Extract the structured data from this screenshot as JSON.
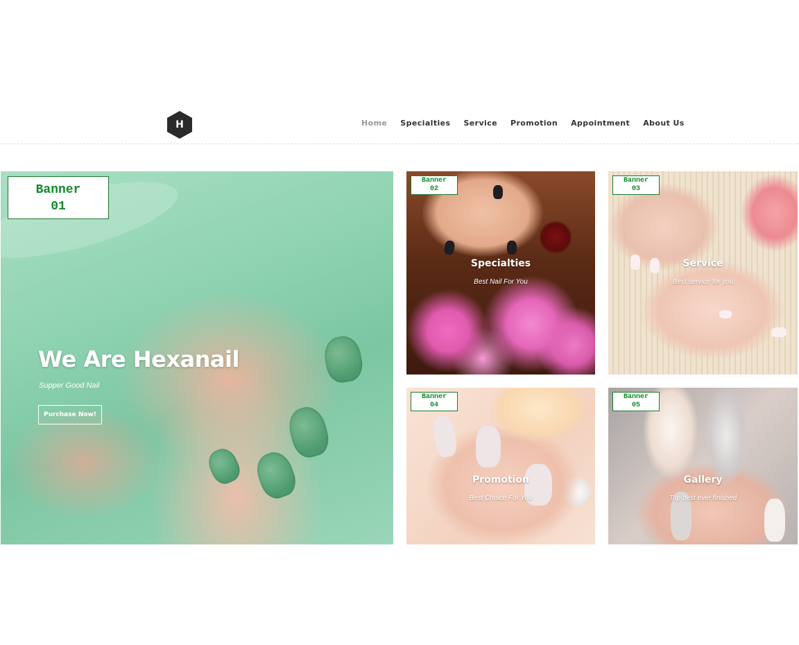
{
  "header": {
    "logo_letter": "H",
    "nav": [
      {
        "label": "Home",
        "active": true
      },
      {
        "label": "Specialties",
        "active": false
      },
      {
        "label": "Service",
        "active": false
      },
      {
        "label": "Promotion",
        "active": false
      },
      {
        "label": "Appointment",
        "active": false
      },
      {
        "label": "About Us",
        "active": false
      }
    ]
  },
  "hero": {
    "banner_line1": "Banner",
    "banner_line2": "01",
    "title": "We Are Hexanail",
    "subtitle": "Supper Good Nail",
    "button": "Purchase Now!"
  },
  "tiles": [
    {
      "banner_line1": "Banner",
      "banner_line2": "02",
      "title": "Specialties",
      "subtitle": "Best Nail For You"
    },
    {
      "banner_line1": "Banner",
      "banner_line2": "03",
      "title": "Service",
      "subtitle": "Best service for you"
    },
    {
      "banner_line1": "Banner",
      "banner_line2": "04",
      "title": "Promotion",
      "subtitle": "Best Choice For You"
    },
    {
      "banner_line1": "Banner",
      "banner_line2": "05",
      "title": "Gallery",
      "subtitle": "Top best ever finished"
    }
  ],
  "colors": {
    "logo_bg": "#2b2b2b",
    "nav_text": "#333333",
    "nav_active": "#999999",
    "banner_label": "#128a2a"
  }
}
